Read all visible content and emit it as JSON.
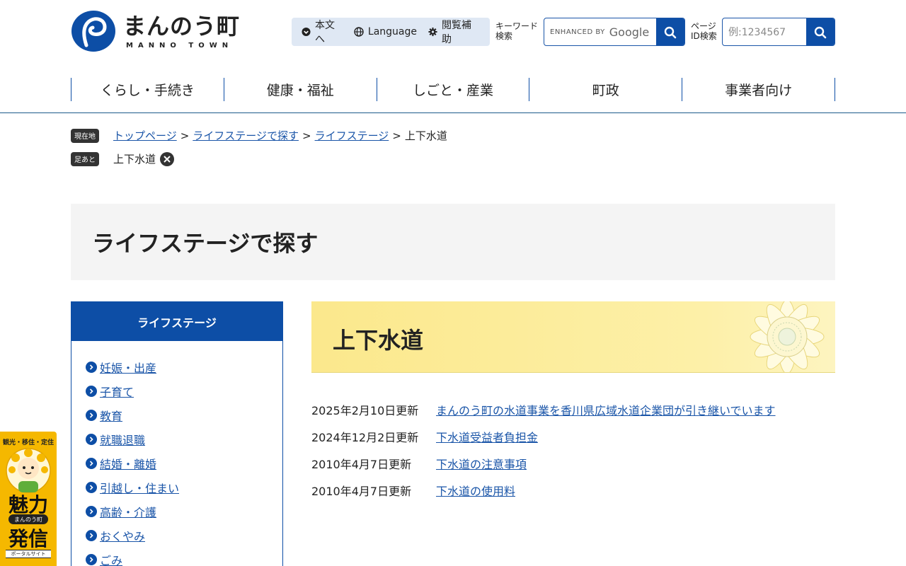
{
  "header": {
    "logo_jp": "まんのう町",
    "logo_en": "MANNO TOWN",
    "util": [
      {
        "label": "本文へ",
        "icon": "chevron-down-circle-icon"
      },
      {
        "label": "Language",
        "icon": "globe-icon"
      },
      {
        "label": "閲覧補助",
        "icon": "gear-icon"
      }
    ],
    "keyword_label_1": "キーワード",
    "keyword_label_2": "検索",
    "google_enhanced": "ENHANCED BY",
    "google_name": "Google",
    "pageid_label_1": "ページ",
    "pageid_label_2": "ID検索",
    "pageid_placeholder": "例:1234567"
  },
  "gnav": [
    "くらし・手続き",
    "健康・福祉",
    "しごと・産業",
    "町政",
    "事業者向け"
  ],
  "breadcrumb": {
    "current_tag": "現在地",
    "items": [
      "トップページ",
      "ライフステージで探す",
      "ライフステージ"
    ],
    "current": "上下水道",
    "history_tag": "足あと",
    "history_item": "上下水道"
  },
  "page_title": "ライフステージで探す",
  "sidebar": {
    "heading": "ライフステージ",
    "items": [
      "妊娠・出産",
      "子育て",
      "教育",
      "就職退職",
      "結婚・離婚",
      "引越し・住まい",
      "高齢・介護",
      "おくやみ",
      "ごみ"
    ]
  },
  "section_title": "上下水道",
  "news": [
    {
      "date": "2025年2月10日更新",
      "title": "まんのう町の水道事業を香川県広域水道企業団が引き継いでいます"
    },
    {
      "date": "2024年12月2日更新",
      "title": "下水道受益者負担金"
    },
    {
      "date": "2010年4月7日更新",
      "title": "下水道の注意事項"
    },
    {
      "date": "2010年4月7日更新",
      "title": "下水道の使用料"
    }
  ],
  "portal": {
    "top": "観光・移住・定住",
    "big1": "魅力",
    "pill": "まんのう町",
    "big2": "発信",
    "bottom": "ポータルサイト"
  },
  "colors": {
    "brand": "#0d4ea6",
    "banner": "#fbe88c",
    "portal": "#f5b800"
  }
}
